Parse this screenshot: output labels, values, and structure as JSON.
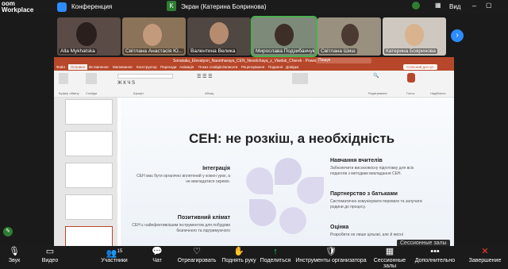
{
  "app": {
    "brand_line1": "oom",
    "brand_line2": "Workplace",
    "meeting_label": "Конференция",
    "share_label": "Экран (Катерина Бояринова)",
    "view_label": "Вид"
  },
  "participants": [
    {
      "name": "Alla Mykhatska"
    },
    {
      "name": "Світлана Анастасія Ю..."
    },
    {
      "name": "Валентина Велика"
    },
    {
      "name": "Мирослава Подзибанчук"
    },
    {
      "name": "Світлана Шиш"
    },
    {
      "name": "Катерина Бояринова"
    }
  ],
  "ppt": {
    "title": "Sonataku_Elevatyon_Naomharaya_CEN_Nevelchaya_z_Viwdsk_Cherek · PowerPoint",
    "search": "Пошук",
    "share": "Спільний доступ",
    "tabs": [
      "Файл",
      "Основне",
      "Вставлення",
      "Малювання",
      "Конструктор",
      "Переходи",
      "Анімація",
      "Показ слайдів",
      "Записати",
      "Рецензування",
      "Подання",
      "Довідка"
    ],
    "groups": [
      "Буфер обміну",
      "Слайди",
      "Шрифт",
      "Абзац",
      "Редагування",
      "Голос",
      "Надійність"
    ]
  },
  "slide": {
    "title": "СЕН: не розкіш, а необхідність",
    "left": [
      {
        "h": "Інтеграція",
        "t": "СЕН має бути органічно вплетений у кожен урок, а не викладатися окремо."
      },
      {
        "h": "Позитивний клімат",
        "t": "СЕН є найефективнішим інструментом для побудови безпечного та підтримуючого"
      }
    ],
    "right": [
      {
        "h": "Навчання вчителів",
        "t": "Забезпечити високоякісну підготовку для всіх педагогів з методики викладання СЕН."
      },
      {
        "h": "Партнерство з батьками",
        "t": "Систематично комунікувати переваги та залучати родини до процесу."
      },
      {
        "h": "Оцінка",
        "t": "Розробити не лише цільові, але й якісні"
      }
    ]
  },
  "session_badge": "Сессионные залы",
  "toolbar": [
    {
      "l": "Звук",
      "i": "🎙"
    },
    {
      "l": "Видео",
      "i": "▭"
    },
    {
      "l": "Участники",
      "i": "👥",
      "c": "15"
    },
    {
      "l": "Чат",
      "i": "💬"
    },
    {
      "l": "Отреагировать",
      "i": "♡"
    },
    {
      "l": "Поднять руку",
      "i": "✋"
    },
    {
      "l": "Поделиться",
      "i": "↑"
    },
    {
      "l": "Инструменты организатора",
      "i": "🛡"
    },
    {
      "l": "Сессионные залы",
      "i": "▦"
    },
    {
      "l": "Дополнительно",
      "i": "•••"
    },
    {
      "l": "Завершение",
      "i": "✕"
    }
  ]
}
